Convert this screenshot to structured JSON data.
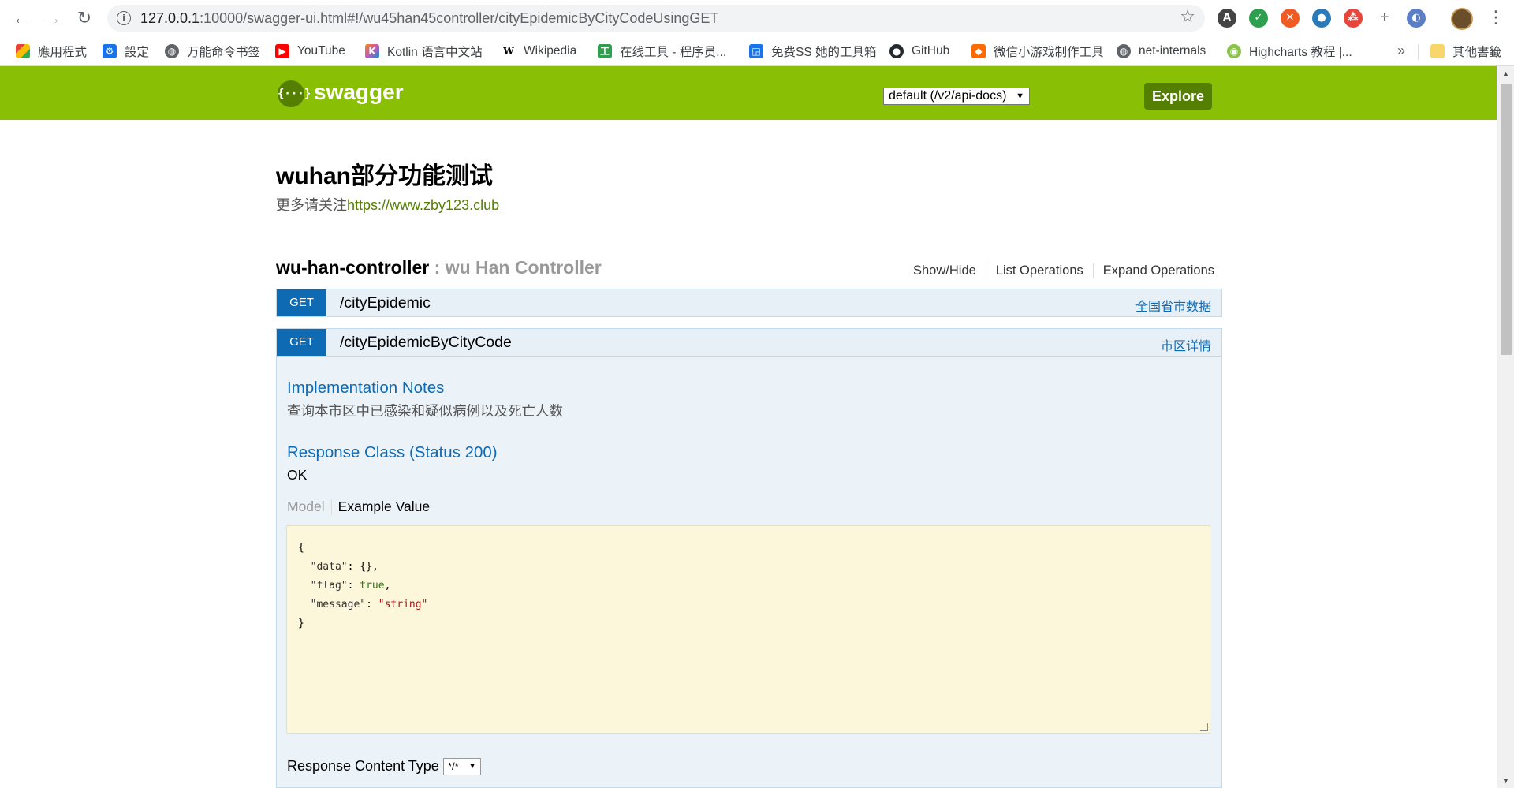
{
  "browser": {
    "url_host": "127.0.0.1",
    "url_rest": ":10000/swagger-ui.html#!/wu45han45controller/cityEpidemicByCityCodeUsingGET",
    "nav": {
      "back": "←",
      "forward": "→",
      "reload": "↻"
    },
    "info_glyph": "i",
    "star_glyph": "☆",
    "menu_glyph": "⋮",
    "extensions": [
      "translate-icon",
      "shield-icon",
      "blocker-icon",
      "globe-icon",
      "network-icon",
      "move-icon",
      "clock-icon"
    ],
    "bookmarks": [
      {
        "label": "應用程式",
        "icon": "apps-icon"
      },
      {
        "label": "設定",
        "icon": "gear-icon"
      },
      {
        "label": "万能命令书签",
        "icon": "globe-icon"
      },
      {
        "label": "YouTube",
        "icon": "youtube-icon"
      },
      {
        "label": "Kotlin 语言中文站",
        "icon": "kotlin-icon"
      },
      {
        "label": "Wikipedia",
        "icon": "wikipedia-icon"
      },
      {
        "label": "在线工具 - 程序员...",
        "icon": "tool-icon"
      },
      {
        "label": "免费SS 她的工具箱",
        "icon": "box-icon"
      },
      {
        "label": "GitHub",
        "icon": "github-icon"
      },
      {
        "label": "微信小游戏制作工具",
        "icon": "game-icon"
      },
      {
        "label": "net-internals",
        "icon": "globe-icon"
      },
      {
        "label": "Highcharts 教程 |...",
        "icon": "highcharts-icon"
      },
      {
        "label": "其他書籤",
        "icon": "folder-icon"
      }
    ],
    "bookmarks_more": "»"
  },
  "swagger": {
    "logo_glyph": "{···}",
    "title": "swagger",
    "spec_select": "default (/v2/api-docs)",
    "explore_label": "Explore"
  },
  "api": {
    "title": "wuhan部分功能测试",
    "desc_prefix": "更多请关注",
    "desc_link": "https://www.zby123.club"
  },
  "resource": {
    "name": "wu-han-controller",
    "separator": " : ",
    "description": "wu Han Controller",
    "links": [
      "Show/Hide",
      "List Operations",
      "Expand Operations"
    ]
  },
  "operations": [
    {
      "method": "GET",
      "path": "/cityEpidemic",
      "summary": "全国省市数据"
    },
    {
      "method": "GET",
      "path": "/cityEpidemicByCityCode",
      "summary": "市区详情"
    }
  ],
  "operation_detail": {
    "impl_title": "Implementation Notes",
    "impl_text": "查询本市区中已感染和疑似病例以及死亡人数",
    "response_class_title": "Response Class (Status 200)",
    "response_class_value": "OK",
    "tab_model": "Model",
    "tab_example": "Example Value",
    "example_json": {
      "open": "{",
      "data_key": "\"data\"",
      "data_val": "{}",
      "flag_key": "\"flag\"",
      "flag_val": "true",
      "message_key": "\"message\"",
      "message_val": "\"string\"",
      "close": "}"
    },
    "content_type_label": "Response Content Type",
    "content_type_value": "*/*"
  },
  "colors": {
    "swagger_green": "#89bf04",
    "swagger_dark_green": "#547f00",
    "get_blue": "#0f6ab4",
    "get_bg": "#e7f0f7",
    "snippet_bg": "#fcf6db"
  }
}
